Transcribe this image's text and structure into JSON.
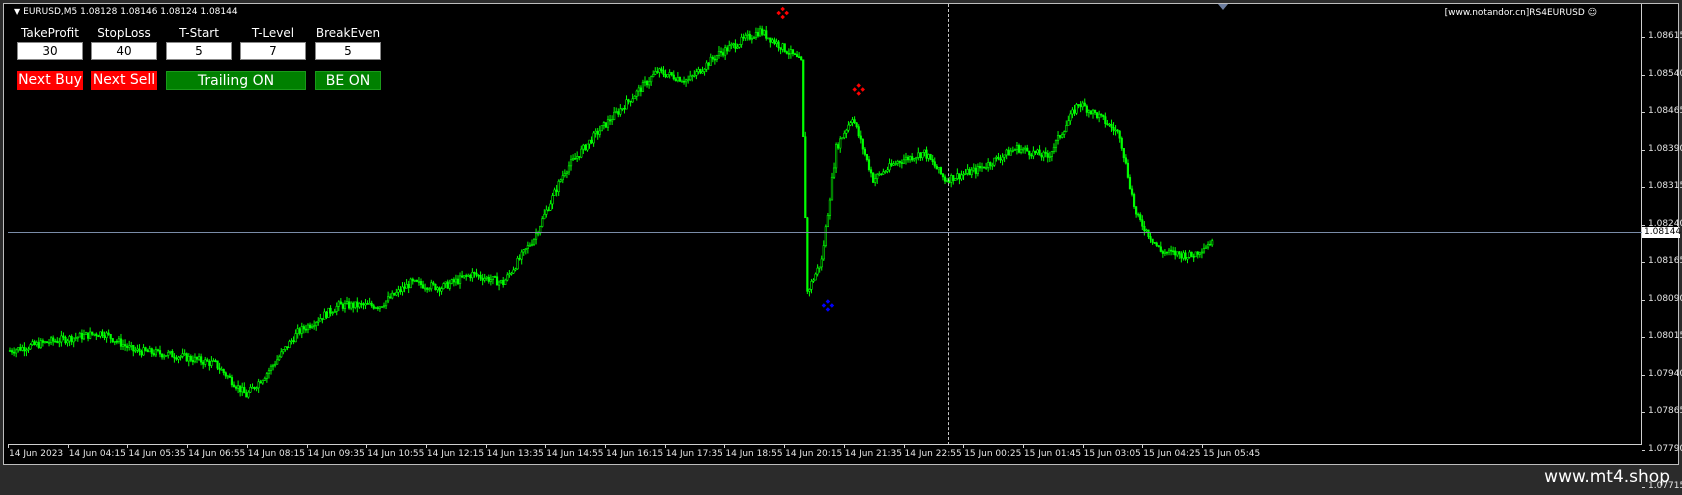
{
  "symbol_info": "EURUSD,M5  1.08128 1.08146 1.08124 1.08144",
  "watermark": "[www.notandor.cn]RS4EURUSD",
  "footer_brand": "www.mt4.shop",
  "panel": {
    "labels": [
      "TakeProfit",
      "StopLoss",
      "T-Start",
      "T-Level",
      "BreakEven"
    ],
    "values": [
      "30",
      "40",
      "5",
      "7",
      "5"
    ],
    "buttons": {
      "next_buy": "Next Buy",
      "next_sell": "Next Sell",
      "trailing": "Trailing ON",
      "be": "BE ON"
    }
  },
  "price_axis": {
    "ticks": [
      "1.08615",
      "1.08540",
      "1.08465",
      "1.08390",
      "1.08315",
      "1.08240",
      "1.08165",
      "1.08090",
      "1.08015",
      "1.07940",
      "1.07865",
      "1.07790",
      "1.07715"
    ],
    "current_price": "1.08144"
  },
  "time_axis": {
    "ticks": [
      "14 Jun 2023",
      "14 Jun 04:15",
      "14 Jun 05:35",
      "14 Jun 06:55",
      "14 Jun 08:15",
      "14 Jun 09:35",
      "14 Jun 10:55",
      "14 Jun 12:15",
      "14 Jun 13:35",
      "14 Jun 14:55",
      "14 Jun 16:15",
      "14 Jun 17:35",
      "14 Jun 18:55",
      "14 Jun 20:15",
      "14 Jun 21:35",
      "14 Jun 22:55",
      "15 Jun 00:25",
      "15 Jun 01:45",
      "15 Jun 03:05",
      "15 Jun 04:25",
      "15 Jun 05:45"
    ]
  },
  "colors": {
    "candle": "#00ff00",
    "sell_marker": "#ff0000",
    "buy_marker": "#0000ff"
  },
  "chart_data": {
    "type": "line",
    "x_unit": "bar index (M5)",
    "ylim": [
      1.0769,
      1.0867
    ],
    "close_path": [
      [
        0,
        1.079
      ],
      [
        20,
        1.0792
      ],
      [
        45,
        1.0794
      ],
      [
        60,
        1.079
      ],
      [
        80,
        1.0789
      ],
      [
        100,
        1.0787
      ],
      [
        115,
        1.078
      ],
      [
        125,
        1.0785
      ],
      [
        140,
        1.0794
      ],
      [
        160,
        1.08
      ],
      [
        180,
        1.08
      ],
      [
        195,
        1.0805
      ],
      [
        210,
        1.0804
      ],
      [
        225,
        1.0807
      ],
      [
        240,
        1.0805
      ],
      [
        255,
        1.0815
      ],
      [
        270,
        1.083
      ],
      [
        285,
        1.0838
      ],
      [
        300,
        1.0845
      ],
      [
        315,
        1.0852
      ],
      [
        330,
        1.085
      ],
      [
        345,
        1.0856
      ],
      [
        365,
        1.0861
      ],
      [
        380,
        1.0856
      ],
      [
        385,
        1.0854
      ],
      [
        388,
        1.0803
      ],
      [
        395,
        1.081
      ],
      [
        402,
        1.0835
      ],
      [
        410,
        1.0842
      ],
      [
        420,
        1.0828
      ],
      [
        432,
        1.0832
      ],
      [
        445,
        1.0834
      ],
      [
        455,
        1.0828
      ],
      [
        470,
        1.083
      ],
      [
        490,
        1.0835
      ],
      [
        505,
        1.0833
      ],
      [
        520,
        1.0845
      ],
      [
        530,
        1.0842
      ],
      [
        540,
        1.0838
      ],
      [
        548,
        1.082
      ],
      [
        560,
        1.0812
      ],
      [
        575,
        1.0811
      ],
      [
        585,
        1.08144
      ]
    ],
    "signals": [
      {
        "type": "sell",
        "bar": 376,
        "price": 1.0865
      },
      {
        "type": "sell",
        "bar": 413,
        "price": 1.0848
      },
      {
        "type": "buy",
        "bar": 398,
        "price": 1.08
      }
    ]
  }
}
